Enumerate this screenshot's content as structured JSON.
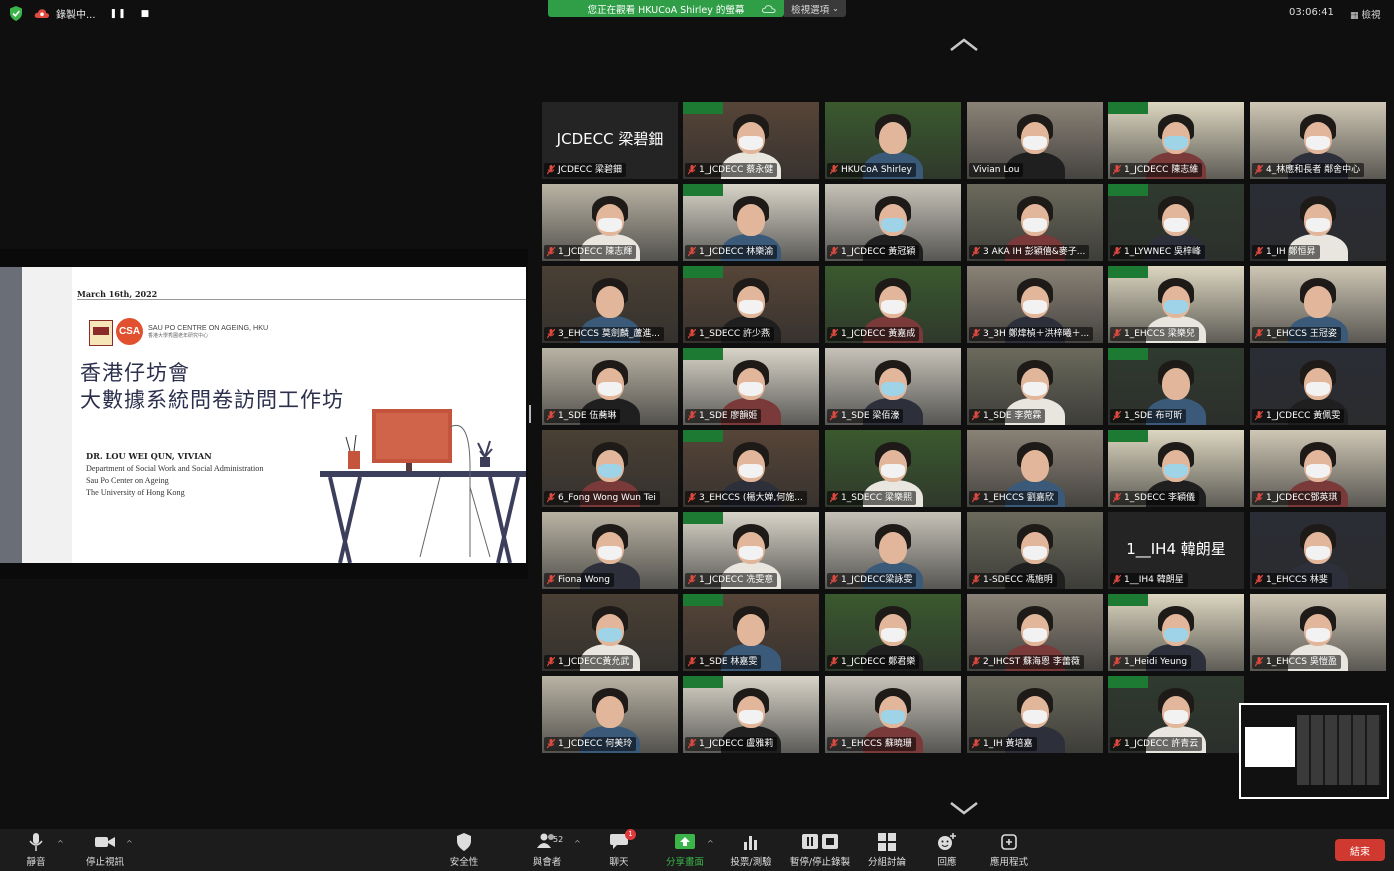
{
  "top": {
    "recording_label": "錄製中...",
    "viewing_banner": "您正在觀看 HKUCoA Shirley 的螢幕",
    "view_options_label": "檢視選項",
    "timer": "03:06:41",
    "view_button_label": "檢視"
  },
  "slide": {
    "date": "March 16th, 2022",
    "org_name": "SAU PO CENTRE ON AGEING, HKU",
    "org_name_cn": "香港大學秀圃老年研究中心",
    "title_line1": "香港仔坊會",
    "title_line2": "大數據系統問卷訪問工作坊",
    "presenter": "DR. LOU WEI QUN, VIVIAN",
    "dept": "Department of Social Work and Social Administration",
    "center": "Sau Po Center on Ageing",
    "university": "The University of Hong Kong"
  },
  "participants": [
    {
      "name": "JCDECC 梁碧鈿",
      "big_name": "JCDECC 梁碧鈿",
      "muted": true
    },
    {
      "name": "1_JCDECC 蔡永健",
      "muted": true
    },
    {
      "name": "HKUCoA Shirley",
      "muted": true
    },
    {
      "name": "Vivian Lou",
      "muted": false,
      "active": true
    },
    {
      "name": "1_JCDECC 陳志維",
      "muted": true
    },
    {
      "name": "4_林應和長者 鄰舍中心",
      "muted": true
    },
    {
      "name": "1_JCDECC 陳志輝",
      "muted": true
    },
    {
      "name": "1_JCDECC 林樂渝",
      "muted": true
    },
    {
      "name": "1_JCDECC 黃冠穎",
      "muted": true
    },
    {
      "name": "3 AKA IH 彭穎僖&麥子...",
      "muted": true
    },
    {
      "name": "1_LYWNEC 吳梓峰",
      "muted": true
    },
    {
      "name": "1_IH 鄭恒昇",
      "muted": true
    },
    {
      "name": "3_EHCCS 莫劍麟_蘆進...",
      "muted": true
    },
    {
      "name": "1_SDECC 許少燕",
      "muted": true
    },
    {
      "name": "1_JCDECC 黃嘉成",
      "muted": true
    },
    {
      "name": "3_3H 鄭煒楨＋洪梓曦＋...",
      "muted": true
    },
    {
      "name": "1_EHCCS 梁樂兒",
      "muted": true
    },
    {
      "name": "1_EHCCS 王冠姿",
      "muted": true
    },
    {
      "name": "1_SDE 伍蕎琳",
      "muted": true
    },
    {
      "name": "1_SDE 廖韻姬",
      "muted": true
    },
    {
      "name": "1_SDE 梁佰濠",
      "muted": true
    },
    {
      "name": "1_SDE 李菀霖",
      "muted": true
    },
    {
      "name": "1_SDE 布可昕",
      "muted": true
    },
    {
      "name": "1_JCDECC 黃佩雯",
      "muted": true
    },
    {
      "name": "6_Fong Wong Wun Tei",
      "muted": true
    },
    {
      "name": "3_EHCCS (楊大婵,何施...",
      "muted": true
    },
    {
      "name": "1_SDECC 梁樂熙",
      "muted": true
    },
    {
      "name": "1_EHCCS 劉嘉欣",
      "muted": true
    },
    {
      "name": "1_SDECC 李穎儀",
      "muted": true
    },
    {
      "name": "1_JCDECC鄧英琪",
      "muted": true
    },
    {
      "name": "Fiona Wong",
      "muted": true
    },
    {
      "name": "1_JCDECC 冼雯意",
      "muted": true
    },
    {
      "name": "1_JCDECC梁詠雯",
      "muted": true
    },
    {
      "name": "1-SDECC 馮施明",
      "muted": true
    },
    {
      "name": "1__IH4 韓朗星",
      "big_name": "1__IH4 韓朗星",
      "muted": true
    },
    {
      "name": "1_EHCCS 林斐",
      "muted": true
    },
    {
      "name": "1_JCDECC黃允武",
      "muted": true
    },
    {
      "name": "1_SDE 林嘉雯",
      "muted": true
    },
    {
      "name": "1_JCDECC 鄭君樂",
      "muted": true
    },
    {
      "name": "2_IHCST 蘇海恩 李蕾薇",
      "muted": true
    },
    {
      "name": "1_Heidi Yeung",
      "muted": true
    },
    {
      "name": "1_EHCCS 吳愷盈",
      "muted": true
    },
    {
      "name": "1_JCDECC 何美玲",
      "muted": true
    },
    {
      "name": "1_JCDECC 盧雅莉",
      "muted": true
    },
    {
      "name": "1_EHCCS 蘇曉珊",
      "muted": true
    },
    {
      "name": "1_IH 黃培嘉",
      "muted": true
    },
    {
      "name": "1_JCDECC 許青云",
      "muted": true
    }
  ],
  "toolbar": {
    "mute": "靜音",
    "stop_video": "停止視訊",
    "security": "安全性",
    "participants": "與會者",
    "participant_count": "52",
    "chat": "聊天",
    "chat_badge": "1",
    "share": "分享畫面",
    "polls": "投票/測驗",
    "pause_record": "暫停/停止錄製",
    "breakout": "分組討論",
    "reactions": "回應",
    "apps": "應用程式",
    "end": "結束"
  },
  "colors": {
    "accent_green": "#2f9e47",
    "end_red": "#d0392f",
    "active_outline": "#3bb54a"
  }
}
